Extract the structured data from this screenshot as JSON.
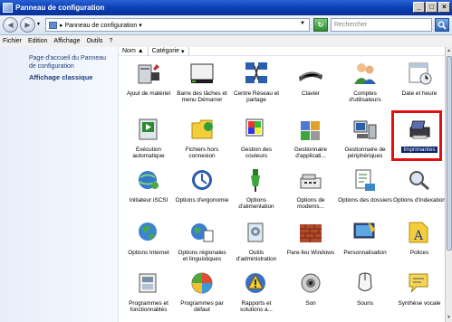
{
  "window": {
    "title": "Panneau de configuration",
    "buttons": [
      "_",
      "□",
      "×"
    ]
  },
  "address": {
    "path": "▸ Panneau de configuration ▾",
    "search_placeholder": "Rechercher"
  },
  "menu": [
    "Fichier",
    "Edition",
    "Affichage",
    "Outils",
    "?"
  ],
  "left_pane": {
    "home_link": "Page d'accueil du Panneau de configuration",
    "classic_view": "Affichage classique"
  },
  "columns": {
    "name": "Nom",
    "sort_indicator": "▲",
    "category": "Catégorie"
  },
  "items": [
    {
      "label": "Ajout de matériel",
      "icon": "hardware-icon"
    },
    {
      "label": "Barre des tâches et menu Démarrer",
      "icon": "taskbar-icon"
    },
    {
      "label": "Centre Réseau et partage",
      "icon": "network-icon"
    },
    {
      "label": "Clavier",
      "icon": "keyboard-icon"
    },
    {
      "label": "Comptes d'utilisateurs",
      "icon": "users-icon"
    },
    {
      "label": "Date et heure",
      "icon": "calendar-icon"
    },
    {
      "label": "Exécution automatique",
      "icon": "autoplay-icon"
    },
    {
      "label": "Fichiers hors connexion",
      "icon": "offline-files-icon"
    },
    {
      "label": "Gestion des couleurs",
      "icon": "color-management-icon"
    },
    {
      "label": "Gestionnaire d'applicati...",
      "icon": "app-manager-icon"
    },
    {
      "label": "Gestionnaire de périphériques",
      "icon": "device-manager-icon"
    },
    {
      "label": "Imprimantes",
      "icon": "printer-icon",
      "selected": true
    },
    {
      "label": "Initiateur iSCSI",
      "icon": "iscsi-icon"
    },
    {
      "label": "Options d'ergonomie",
      "icon": "ease-of-access-icon"
    },
    {
      "label": "Options d'alimentation",
      "icon": "power-icon"
    },
    {
      "label": "Options de modems...",
      "icon": "modem-icon"
    },
    {
      "label": "Options des dossiers",
      "icon": "folder-options-icon"
    },
    {
      "label": "Options d'indexation",
      "icon": "indexing-icon"
    },
    {
      "label": "Options Internet",
      "icon": "internet-icon"
    },
    {
      "label": "Options régionales et linguistiques",
      "icon": "regional-icon"
    },
    {
      "label": "Outils d'administration",
      "icon": "admin-tools-icon"
    },
    {
      "label": "Pare-feu Windows",
      "icon": "firewall-icon"
    },
    {
      "label": "Personnalisation",
      "icon": "personalization-icon"
    },
    {
      "label": "Polices",
      "icon": "fonts-icon"
    },
    {
      "label": "Programmes et fonctionnalités",
      "icon": "programs-icon"
    },
    {
      "label": "Programmes par défaut",
      "icon": "default-programs-icon"
    },
    {
      "label": "Rapports et solutions a...",
      "icon": "reports-icon"
    },
    {
      "label": "Son",
      "icon": "sound-icon"
    },
    {
      "label": "Souris",
      "icon": "mouse-icon"
    },
    {
      "label": "Synthèse vocale",
      "icon": "speech-icon"
    }
  ]
}
